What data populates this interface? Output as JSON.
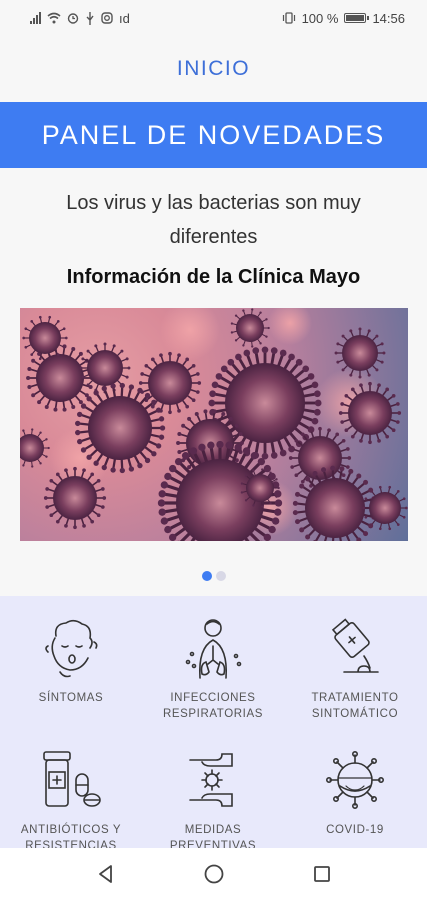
{
  "status_bar": {
    "indicators": "ıd",
    "battery_percent": "100 %",
    "battery_level": 1.0,
    "time": "14:56",
    "icons": [
      "signal-icon",
      "wifi-icon",
      "alarm-icon",
      "usb-icon",
      "instagram-icon",
      "vibrate-icon",
      "battery-icon"
    ]
  },
  "header": {
    "title": "INICIO"
  },
  "banner": {
    "title": "PANEL DE NOVEDADES"
  },
  "news": {
    "title": "Los virus y las bacterias son muy diferentes",
    "source": "Información de la Clínica Mayo",
    "carousel": {
      "count": 2,
      "active": 0
    }
  },
  "categories": [
    {
      "label": "SÍNTOMAS",
      "icon": "sick-face-icon"
    },
    {
      "label": "INFECCIONES RESPIRATORIAS",
      "icon": "lungs-icon"
    },
    {
      "label": "TRATAMIENTO SINTOMÁTICO",
      "icon": "medicine-bottle-icon"
    },
    {
      "label": "ANTIBIÓTICOS Y RESISTENCIAS",
      "icon": "pill-bottle-icon"
    },
    {
      "label": "MEDIDAS PREVENTIVAS",
      "icon": "hands-virus-icon"
    },
    {
      "label": "COVID-19",
      "icon": "coronavirus-icon"
    }
  ],
  "nav": {
    "icons": [
      "back-icon",
      "home-icon",
      "recents-icon"
    ]
  },
  "colors": {
    "accent": "#3e7cf2",
    "header_text": "#3d6fd8",
    "grid_bg": "#e8e9fb",
    "dot_active": "#3e7cf2",
    "dot_inactive": "#d8d8e6"
  }
}
